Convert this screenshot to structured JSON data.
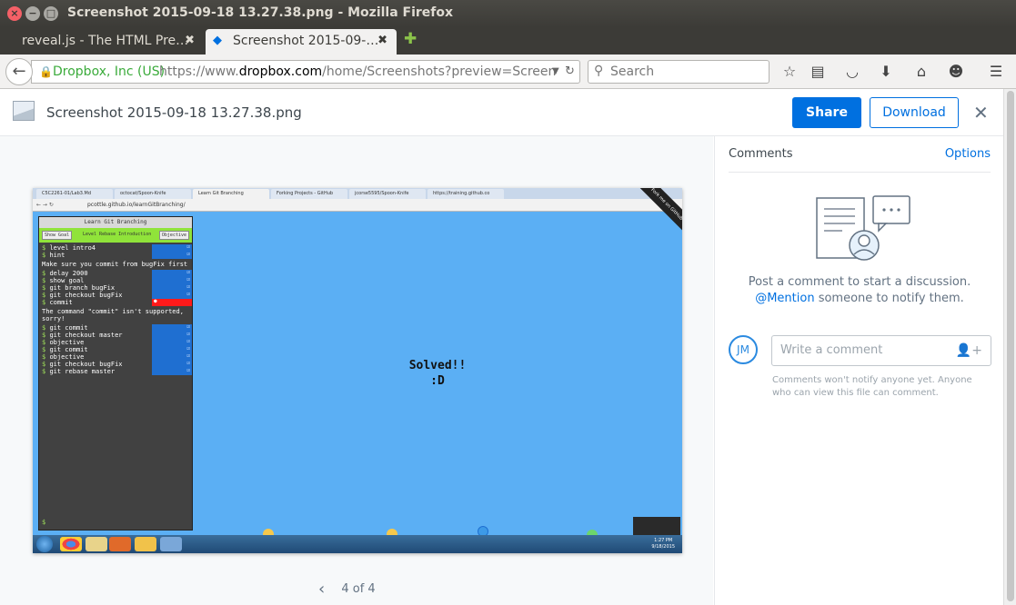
{
  "window": {
    "title": "Screenshot 2015-09-18 13.27.38.png - Mozilla Firefox",
    "close_glyph": "×",
    "minimize_glyph": "−",
    "maximize_glyph": "□"
  },
  "tabs": [
    {
      "label": "reveal.js - The HTML Pre…",
      "close": "✖"
    },
    {
      "label": "Screenshot 2015-09-…",
      "close": "✖"
    }
  ],
  "new_tab_glyph": "✚",
  "nav": {
    "site_identity": "Dropbox, Inc (US)",
    "url_prefix": "https://www.",
    "url_domain": "dropbox.com",
    "url_rest": "/home/Screenshots?preview=Screen",
    "search_placeholder": "Search"
  },
  "viewer": {
    "file_title": "Screenshot 2015-09-18 13.27.38.png",
    "share_label": "Share",
    "download_label": "Download",
    "pager_text": "4 of 4"
  },
  "inner_screenshot": {
    "tabs": [
      "C5C2261-01/Lab3.Md",
      "octocat/Spoon-Knife",
      "Learn Git Branching",
      "Forking Projects - GitHub",
      "jcorse5595/Spoon-Knife",
      "https://training.github.co"
    ],
    "url": "pcottle.github.io/learnGitBranching/",
    "terminal_title": "Learn Git Branching",
    "show_goal": "Show Goal",
    "level_label": "Level Rebase Introduction",
    "objective_btn": "Objective",
    "lines_a": [
      "level intro4",
      "hint"
    ],
    "msg1": "Make sure you commit from bugFix first",
    "lines_b": [
      "delay 2000",
      "show goal",
      "git branch bugFix",
      "git checkout bugFix",
      "commit"
    ],
    "msg2": "The command \"commit\" isn't supported, sorry!",
    "lines_c": [
      "git commit",
      "git checkout master",
      "objective",
      "git commit",
      "objective",
      "git checkout bugFix",
      "git rebase master"
    ],
    "solved_line1": "Solved!!",
    "solved_line2": ":D",
    "fork_banner": "Fork me on GitHub",
    "clock_time": "1:27 PM",
    "clock_date": "9/18/2015",
    "prompt": "$"
  },
  "comments": {
    "heading": "Comments",
    "options_label": "Options",
    "empty_line1": "Post a comment to start a discussion.",
    "mention": "@Mention",
    "empty_line2_rest": " someone to notify them.",
    "avatar_initials": "JM",
    "input_placeholder": "Write a comment",
    "note": "Comments won't notify anyone yet. Anyone who can view this file can comment."
  },
  "colors": {
    "accent": "#0070e0",
    "canvas": "#5baff4",
    "level_bar": "#90e33a"
  }
}
